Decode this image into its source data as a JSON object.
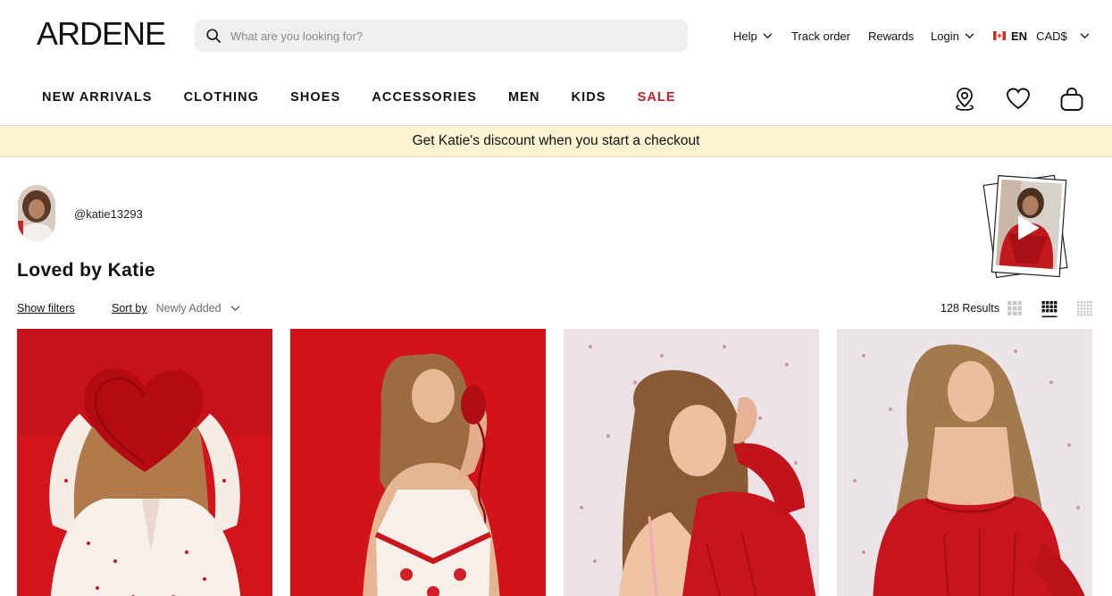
{
  "brand": {
    "logo_text": "ARDENE"
  },
  "search": {
    "placeholder": "What are you looking for?",
    "icon": "search-icon"
  },
  "utility_nav": {
    "help": "Help",
    "track_order": "Track order",
    "rewards": "Rewards",
    "login": "Login",
    "language": "EN",
    "currency": "CAD$"
  },
  "main_nav": {
    "items": [
      "NEW ARRIVALS",
      "CLOTHING",
      "SHOES",
      "ACCESSORIES",
      "MEN",
      "KIDS",
      "SALE"
    ],
    "sale_color": "#c41e24",
    "icons": [
      "store-locator-icon",
      "wishlist-heart-icon",
      "shopping-bag-icon"
    ]
  },
  "banner": {
    "text": "Get Katie's discount when you start a checkout",
    "background": "#fbf3d2"
  },
  "profile": {
    "username": "@katie13293",
    "title": "Loved by Katie"
  },
  "toolbar": {
    "show_filters": "Show filters",
    "sort_label": "Sort by",
    "sort_value": "Newly Added",
    "results": "128 Results",
    "grid_options": [
      "grid-2-icon",
      "grid-3-icon",
      "grid-4-icon"
    ],
    "selected_grid": "grid-3-icon"
  },
  "products": [
    {
      "image": "model-with-red-heart-pillow"
    },
    {
      "image": "model-with-red-phone"
    },
    {
      "image": "model-in-red-sweater-hand-in-hair"
    },
    {
      "image": "model-in-red-off-shoulder-sweater"
    }
  ],
  "colors": {
    "accent_red": "#c41e24",
    "search_bg": "#efefef"
  }
}
